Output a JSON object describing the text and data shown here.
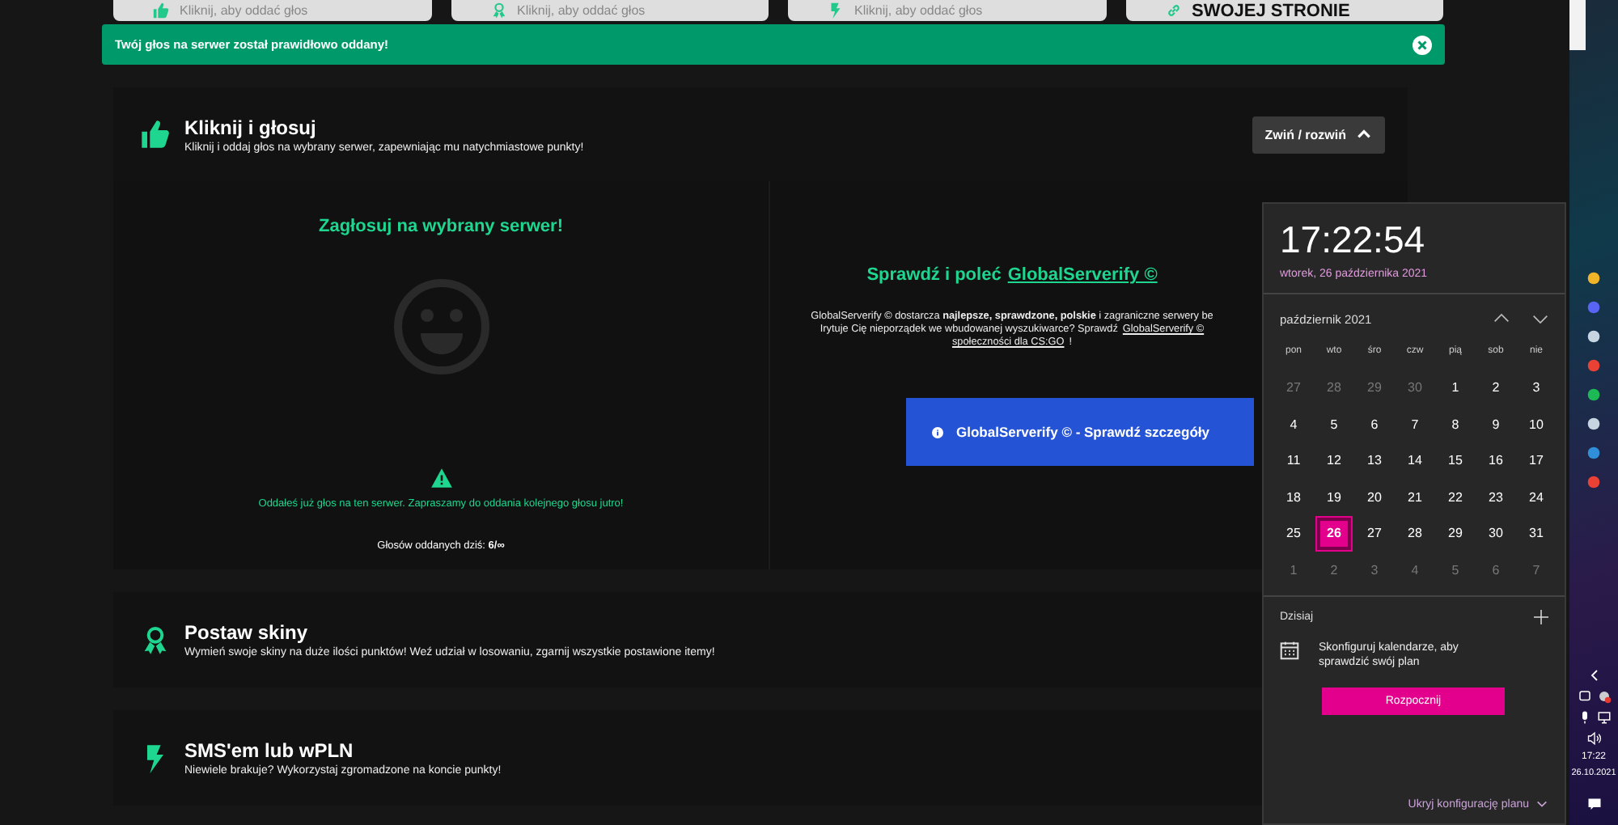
{
  "top_cards": [
    {
      "kind": "vote",
      "text": "Kliknij, aby oddać głos"
    },
    {
      "kind": "award",
      "text": "Kliknij, aby oddać głos"
    },
    {
      "kind": "bolt",
      "text": "Kliknij, aby oddać głos"
    },
    {
      "kind": "link",
      "text": "SWOJEJ STRONIE"
    }
  ],
  "alert": {
    "message": "Twój głos na serwer został prawidłowo oddany!"
  },
  "vote_panel": {
    "title": "Kliknij i głosuj",
    "description": "Kliknij i oddaj głos na wybrany serwer, zapewniając mu natychmiastowe punkty!",
    "toggle": "Zwiń / rozwiń",
    "expanded": true,
    "left": {
      "heading": "Zagłosuj na wybrany serwer!",
      "notice": "Oddałeś już głos na ten serwer. Zapraszamy do oddania kolejnego głosu jutro!",
      "votes_today": "Głosów oddanych dziś: **6/∞**"
    },
    "right": {
      "heading": "Sprawdź i poleć",
      "heading_link": "GlobalServerify ©",
      "lines": [
        {
          "text": "GlobalServerify © dostarcza **najlepsze, sprawdzone, polskie** i zagraniczne serwery be"
        },
        {
          "text": "Irytuje Cię nieporządek we wbudowanej wyszukiwarce? Sprawdź",
          "link": "GlobalServerify ©"
        },
        {
          "link": "społeczności dla CS:GO",
          "text": "!"
        }
      ],
      "button": "GlobalServerify © - Sprawdź szczegóły"
    }
  },
  "sections": [
    {
      "kind": "award",
      "title": "Postaw skiny",
      "description": "Wymień swoje skiny na duże ilości punktów! Weź udział w losowaniu, zgarnij wszystkie postawione itemy!"
    },
    {
      "kind": "bolt",
      "title": "SMS'em lub wPLN",
      "description": "Niewiele brakuje? Wykorzystaj zgromadzone na koncie punkty!"
    }
  ],
  "calendar_flyout": {
    "time": "17:22:54",
    "date": "wtorek, 26 października 2021",
    "month": "październik 2021",
    "weekdays": [
      "pon",
      "wto",
      "śro",
      "czw",
      "pią",
      "sob",
      "nie"
    ],
    "weeks": [
      [
        {
          "label": "27",
          "in_month": false,
          "selected": false
        },
        {
          "label": "28",
          "in_month": false,
          "selected": false
        },
        {
          "label": "29",
          "in_month": false,
          "selected": false
        },
        {
          "label": "30",
          "in_month": false,
          "selected": false
        },
        {
          "label": "1",
          "in_month": true,
          "selected": false
        },
        {
          "label": "2",
          "in_month": true,
          "selected": false
        },
        {
          "label": "3",
          "in_month": true,
          "selected": false
        }
      ],
      [
        {
          "label": "4",
          "in_month": true,
          "selected": false
        },
        {
          "label": "5",
          "in_month": true,
          "selected": false
        },
        {
          "label": "6",
          "in_month": true,
          "selected": false
        },
        {
          "label": "7",
          "in_month": true,
          "selected": false
        },
        {
          "label": "8",
          "in_month": true,
          "selected": false
        },
        {
          "label": "9",
          "in_month": true,
          "selected": false
        },
        {
          "label": "10",
          "in_month": true,
          "selected": false
        }
      ],
      [
        {
          "label": "11",
          "in_month": true,
          "selected": false
        },
        {
          "label": "12",
          "in_month": true,
          "selected": false
        },
        {
          "label": "13",
          "in_month": true,
          "selected": false
        },
        {
          "label": "14",
          "in_month": true,
          "selected": false
        },
        {
          "label": "15",
          "in_month": true,
          "selected": false
        },
        {
          "label": "16",
          "in_month": true,
          "selected": false
        },
        {
          "label": "17",
          "in_month": true,
          "selected": false
        }
      ],
      [
        {
          "label": "18",
          "in_month": true,
          "selected": false
        },
        {
          "label": "19",
          "in_month": true,
          "selected": false
        },
        {
          "label": "20",
          "in_month": true,
          "selected": false
        },
        {
          "label": "21",
          "in_month": true,
          "selected": false
        },
        {
          "label": "22",
          "in_month": true,
          "selected": false
        },
        {
          "label": "23",
          "in_month": true,
          "selected": false
        },
        {
          "label": "24",
          "in_month": true,
          "selected": false
        }
      ],
      [
        {
          "label": "25",
          "in_month": true,
          "selected": false
        },
        {
          "label": "26",
          "in_month": true,
          "selected": true
        },
        {
          "label": "27",
          "in_month": true,
          "selected": false
        },
        {
          "label": "28",
          "in_month": true,
          "selected": false
        },
        {
          "label": "29",
          "in_month": true,
          "selected": false
        },
        {
          "label": "30",
          "in_month": true,
          "selected": false
        },
        {
          "label": "31",
          "in_month": true,
          "selected": false
        }
      ],
      [
        {
          "label": "1",
          "in_month": false,
          "selected": false
        },
        {
          "label": "2",
          "in_month": false,
          "selected": false
        },
        {
          "label": "3",
          "in_month": false,
          "selected": false
        },
        {
          "label": "4",
          "in_month": false,
          "selected": false
        },
        {
          "label": "5",
          "in_month": false,
          "selected": false
        },
        {
          "label": "6",
          "in_month": false,
          "selected": false
        },
        {
          "label": "7",
          "in_month": false,
          "selected": false
        }
      ]
    ],
    "agenda_title": "Dzisiaj",
    "agenda_message": "Skonfiguruj kalendarze, aby sprawdzić swój plan",
    "start_button": "Rozpocznij",
    "hide_link": "Ukryj konfigurację planu"
  },
  "taskbar": {
    "time": "17:22",
    "date": "26.10.2021"
  }
}
